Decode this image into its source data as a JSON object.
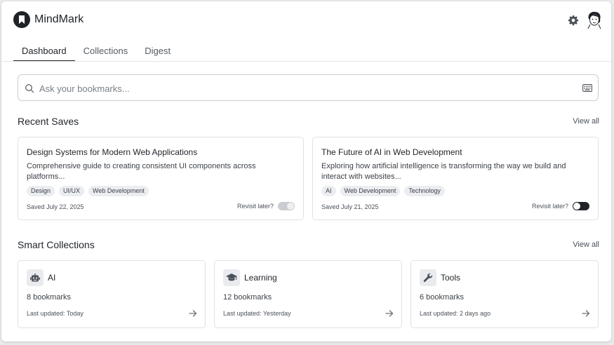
{
  "app": {
    "name": "MindMark"
  },
  "tabs": [
    {
      "label": "Dashboard",
      "active": true
    },
    {
      "label": "Collections",
      "active": false
    },
    {
      "label": "Digest",
      "active": false
    }
  ],
  "search": {
    "placeholder": "Ask your bookmarks...",
    "value": ""
  },
  "recent": {
    "title": "Recent Saves",
    "view_all": "View all",
    "cards": [
      {
        "title": "Design Systems for Modern Web Applications",
        "description": "Comprehensive guide to creating consistent UI components across platforms...",
        "tags": [
          "Design",
          "UI/UX",
          "Web Development"
        ],
        "saved": "Saved July 22, 2025",
        "revisit_label": "Revisit later?",
        "revisit": false
      },
      {
        "title": "The Future of AI in Web Development",
        "description": "Exploring how artificial intelligence is transforming the way we build and interact with websites...",
        "tags": [
          "AI",
          "Web Development",
          "Technology"
        ],
        "saved": "Saved July 21, 2025",
        "revisit_label": "Revisit later?",
        "revisit": true
      }
    ]
  },
  "collections": {
    "title": "Smart Collections",
    "view_all": "View all",
    "items": [
      {
        "name": "AI",
        "icon": "robot-icon",
        "count": "8 bookmarks",
        "updated": "Last updated: Today"
      },
      {
        "name": "Learning",
        "icon": "graduation-cap-icon",
        "count": "12 bookmarks",
        "updated": "Last updated: Yesterday"
      },
      {
        "name": "Tools",
        "icon": "wrench-icon",
        "count": "6 bookmarks",
        "updated": "Last updated: 2 days ago"
      }
    ]
  },
  "colors": {
    "primary": "#1f2328",
    "border": "#dfe1e4",
    "tag_bg": "#ebedf0",
    "background": "#e9eaec"
  }
}
